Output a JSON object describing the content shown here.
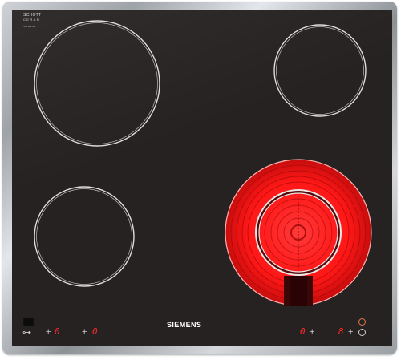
{
  "glass_brand": {
    "line1": "SCHOTT",
    "line2": "CERAN",
    "line3": "SIEMENS"
  },
  "brand": "SIEMENS",
  "controls": {
    "lock_symbol": "⊶",
    "left_zone_display_1": "0",
    "left_zone_display_2": "0",
    "right_zone_display_1": "0",
    "right_zone_display_2": "8",
    "zone_symbol": "+"
  },
  "colors": {
    "glass": "#262221",
    "ring": "#dedede",
    "heat": "#ff1a1a",
    "display": "#ff2a2a"
  }
}
